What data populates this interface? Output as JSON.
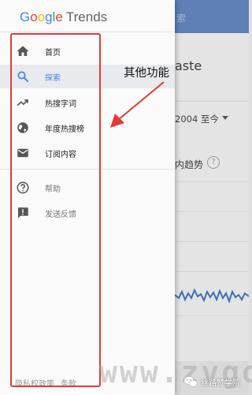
{
  "background_app": {
    "header_text": "索",
    "search_term": "aste",
    "date_range": "2004 至今",
    "trend_label": "内趋势"
  },
  "drawer": {
    "logo_google": [
      "G",
      "o",
      "o",
      "g",
      "l",
      "e"
    ],
    "logo_trends": "Trends",
    "items": [
      {
        "label": "首页",
        "icon": "home-icon"
      },
      {
        "label": "探索",
        "icon": "search-icon",
        "active": true
      },
      {
        "label": "热搜字词",
        "icon": "trending-up-icon"
      },
      {
        "label": "年度热搜榜",
        "icon": "globe-icon"
      },
      {
        "label": "订阅内容",
        "icon": "mail-icon"
      },
      {
        "label": "帮助",
        "icon": "help-icon"
      },
      {
        "label": "发送反馈",
        "icon": "feedback-icon"
      }
    ],
    "footer": [
      "隐私权政策",
      "条款"
    ]
  },
  "annotation": {
    "text": "其他功能",
    "color": "#e53935"
  },
  "watermarks": {
    "site": "www.zvgo.com",
    "badge": "丝路赞学院"
  },
  "colors": {
    "accent": "#4285f4",
    "header_blue": "#5f7fb6",
    "highlight_red": "#e53935"
  }
}
